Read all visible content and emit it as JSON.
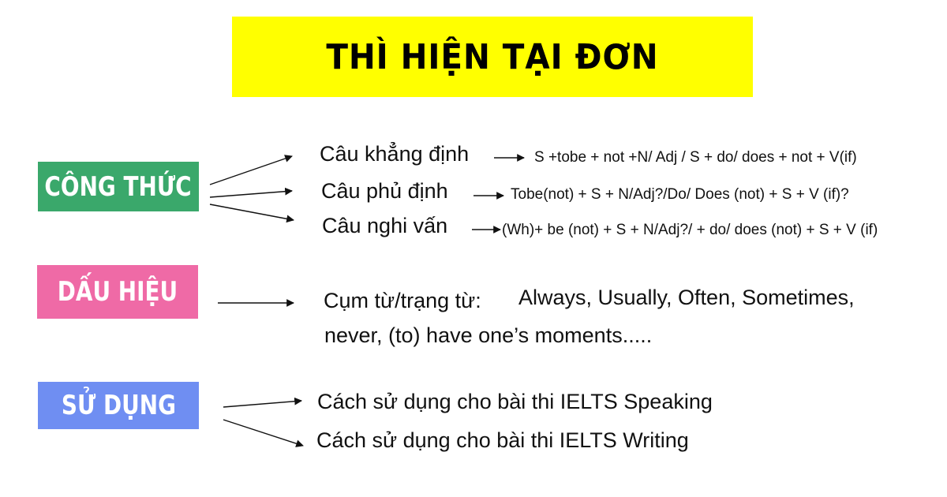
{
  "title": "THÌ HIỆN TẠI ĐƠN",
  "sections": {
    "cong_thuc": {
      "label": "CÔNG THỨC",
      "color": "#3aa86b",
      "items": [
        {
          "type": "Câu khẳng định",
          "formula": "S +tobe + not +N/ Adj / S + do/ does + not + V(if)"
        },
        {
          "type": "Câu phủ định",
          "formula": "Tobe(not) + S + N/Adj?/Do/ Does (not) + S + V (if)?"
        },
        {
          "type": "Câu nghi vấn",
          "formula": "(Wh)+ be (not) + S + N/Adj?/ + do/ does (not) + S + V (if)"
        }
      ]
    },
    "dau_hieu": {
      "label": "DẤU HIỆU",
      "color": "#ef6aa6",
      "prefix": "Cụm từ/trạng từ:",
      "words": "Always, Usually, Often, Sometimes,",
      "words_line2": "never, (to) have one’s moments....."
    },
    "su_dung": {
      "label": "SỬ DỤNG",
      "color": "#6f8ef2",
      "items": [
        "Cách sử dụng cho bài thi IELTS Speaking",
        "Cách sử dụng cho bài thi IELTS Writing"
      ]
    }
  },
  "colors": {
    "title_bg": "#ffff00",
    "text": "#111111"
  }
}
